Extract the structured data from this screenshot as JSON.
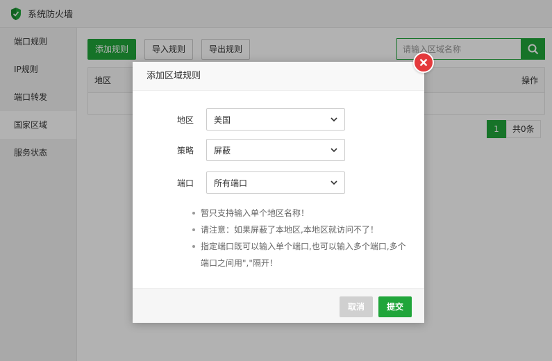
{
  "window": {
    "title": "系统防火墙",
    "icon": "shield-icon"
  },
  "sidebar": {
    "items": [
      {
        "label": "端口规则"
      },
      {
        "label": "IP规则"
      },
      {
        "label": "端口转发"
      },
      {
        "label": "国家区域",
        "active": true
      },
      {
        "label": "服务状态"
      }
    ]
  },
  "toolbar": {
    "add_label": "添加规则",
    "import_label": "导入规则",
    "export_label": "导出规则"
  },
  "search": {
    "placeholder": "请输入区域名称",
    "icon": "search-icon"
  },
  "table": {
    "columns": [
      "地区",
      "操作"
    ]
  },
  "pager": {
    "current_page": "1",
    "total_text": "共0条"
  },
  "dialog": {
    "title": "添加区域规则",
    "fields": [
      {
        "label": "地区",
        "value": "美国"
      },
      {
        "label": "策略",
        "value": "屏蔽"
      },
      {
        "label": "端口",
        "value": "所有端口"
      }
    ],
    "tips": [
      "暂只支持输入单个地区名称！",
      "请注意：如果屏蔽了本地区,本地区就访问不了！",
      "指定端口既可以输入单个端口,也可以输入多个端口,多个端口之间用\",\"隔开！"
    ],
    "cancel_label": "取消",
    "submit_label": "提交"
  },
  "colors": {
    "accent": "#20a53a",
    "close": "#e4393c"
  }
}
